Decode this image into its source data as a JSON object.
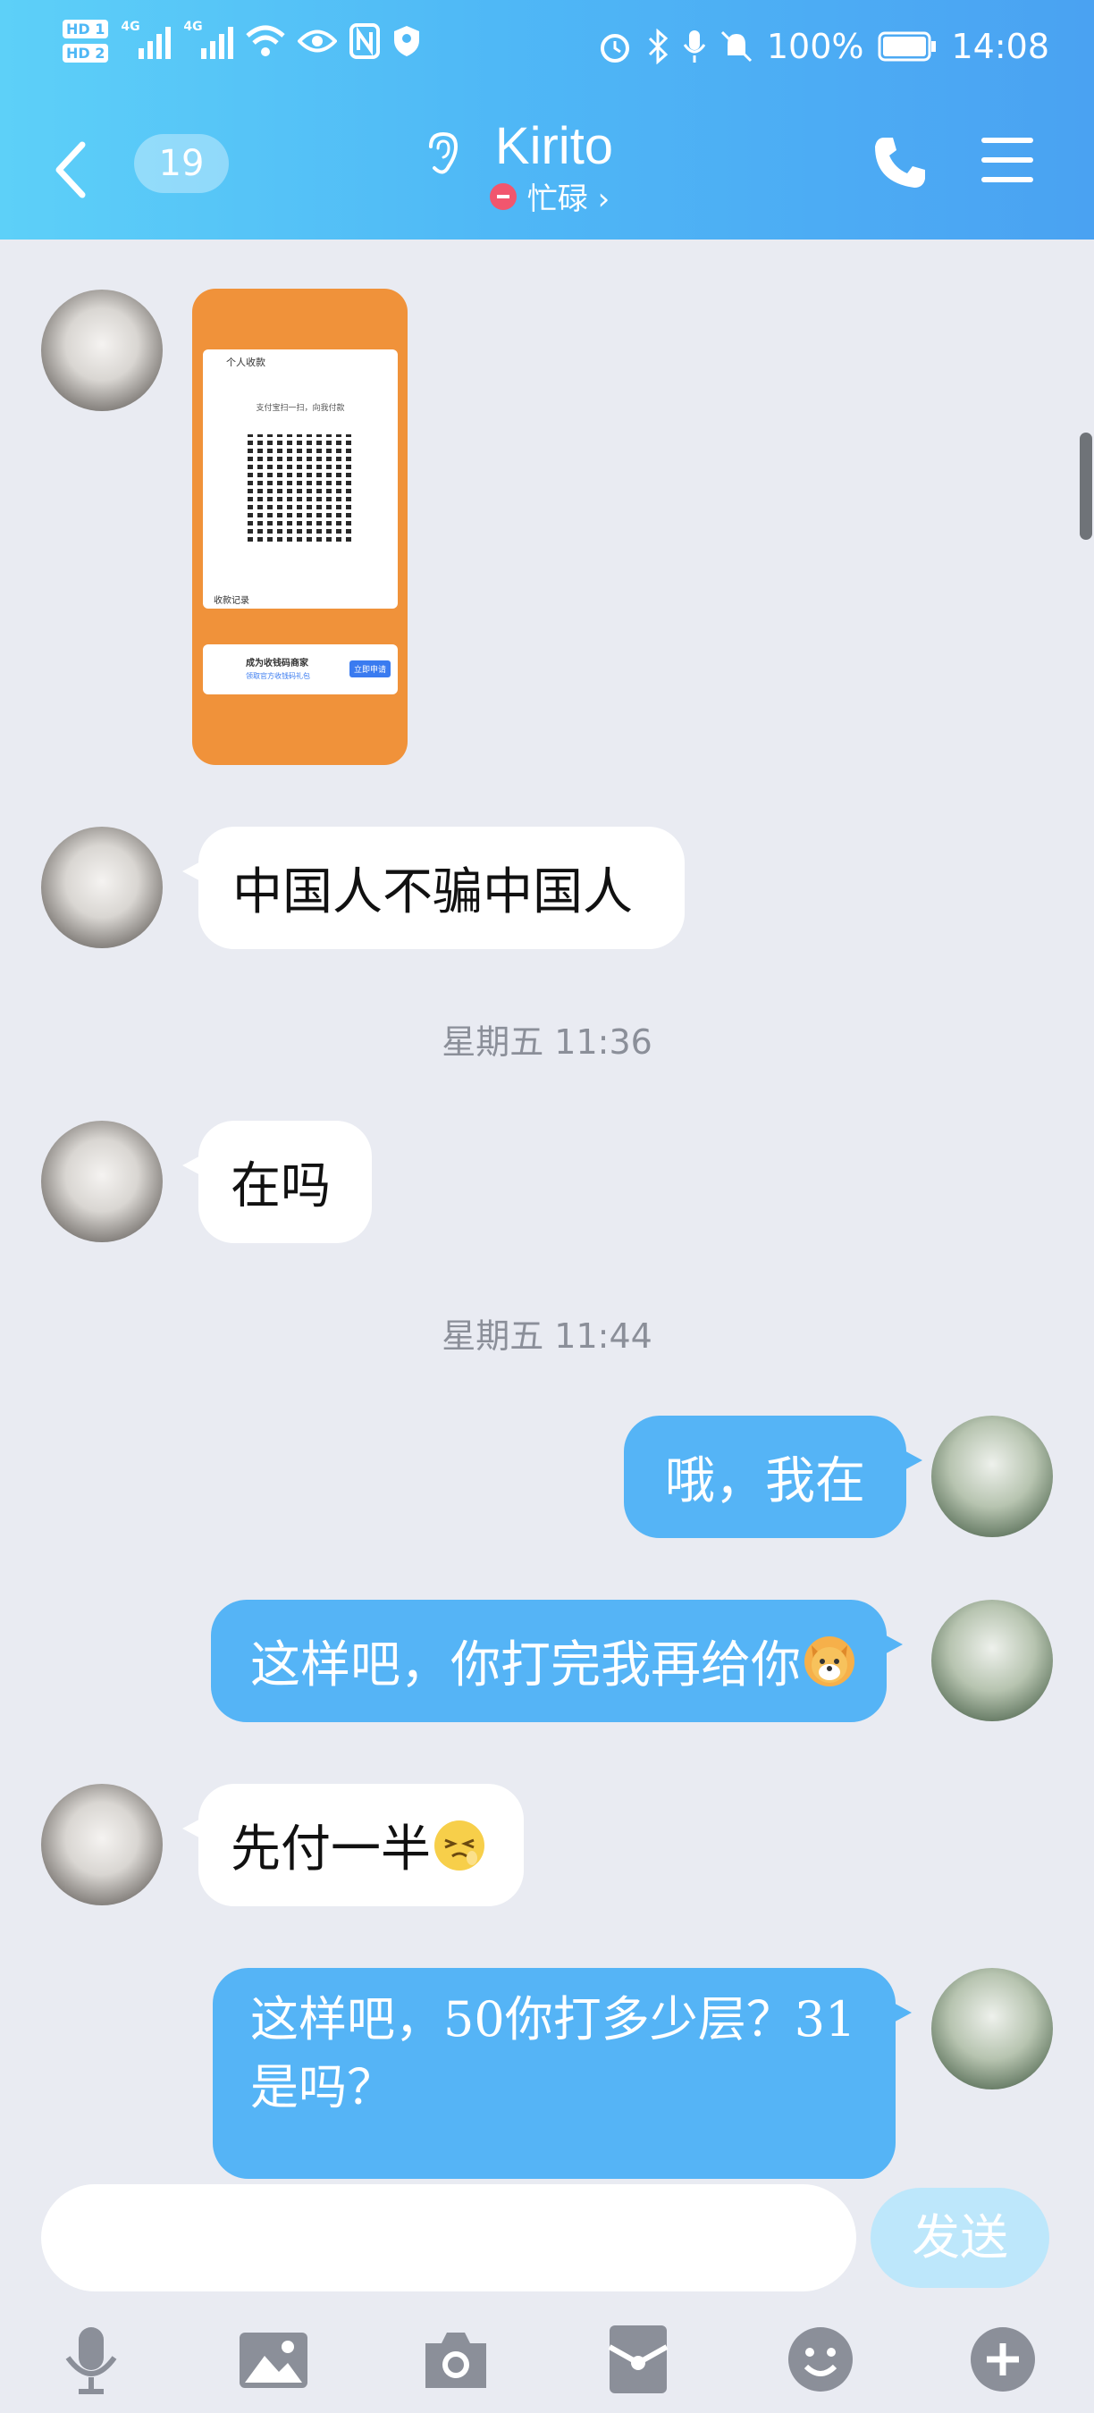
{
  "status_bar": {
    "hd1": "HD 1",
    "hd2": "HD 2",
    "net1": "4G",
    "net2": "4G",
    "battery": "100%",
    "time": "14:08"
  },
  "header": {
    "unread_count": "19",
    "contact_name": "Kirito",
    "contact_status": "忙碌 ›"
  },
  "messages": [
    {
      "side": "in",
      "type": "image",
      "caption_title": "个人收款",
      "caption_line": "支付宝扫一扫，向我付款",
      "ad_title": "成为收钱码商家",
      "ad_sub": "领取官方收钱码礼包",
      "ad_button": "立即申请",
      "record": "收款记录"
    },
    {
      "side": "in",
      "text": "中国人不骗中国人"
    },
    {
      "timestamp": "星期五 11:36"
    },
    {
      "side": "in",
      "text": "在吗"
    },
    {
      "timestamp": "星期五 11:44"
    },
    {
      "side": "out",
      "text": "哦，我在"
    },
    {
      "side": "out",
      "text": "这样吧，你打完我再给你",
      "emoji": "dog-face-emoji"
    },
    {
      "side": "in",
      "text": "先付一半",
      "emoji": "squint-face-emoji"
    },
    {
      "side": "out",
      "text_line1": "这样吧，50你打多少层？31",
      "text_line2": "是吗？"
    }
  ],
  "composer": {
    "placeholder": "",
    "send_label": "发送"
  },
  "toolbar": [
    "microphone-icon",
    "image-icon",
    "camera-icon",
    "red-packet-icon",
    "emoji-icon",
    "plus-icon"
  ],
  "colors": {
    "header_start": "#5dd0f8",
    "header_end": "#4aa2f2",
    "outgoing_bubble": "#55b4f6",
    "incoming_bubble": "#ffffff",
    "background": "#e9ebf2"
  }
}
